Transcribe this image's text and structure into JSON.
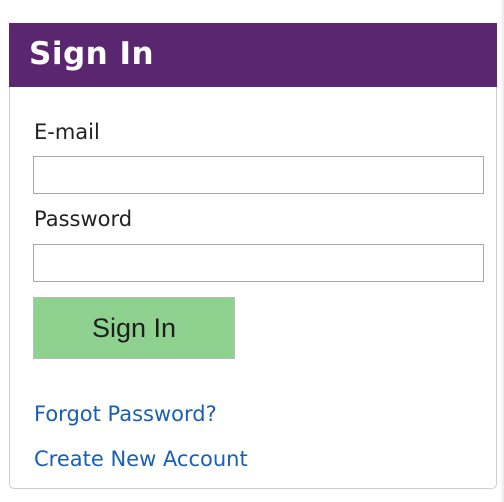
{
  "signin_panel": {
    "title": "Sign In",
    "email_label": "E-mail",
    "email_value": "",
    "password_label": "Password",
    "password_value": "",
    "submit_label": "Sign In",
    "forgot_password_link": "Forgot Password?",
    "create_account_link": "Create New Account"
  },
  "colors": {
    "header_background": "#5b2670",
    "button_background": "#8fd18f",
    "link_color": "#1a5fb4"
  }
}
